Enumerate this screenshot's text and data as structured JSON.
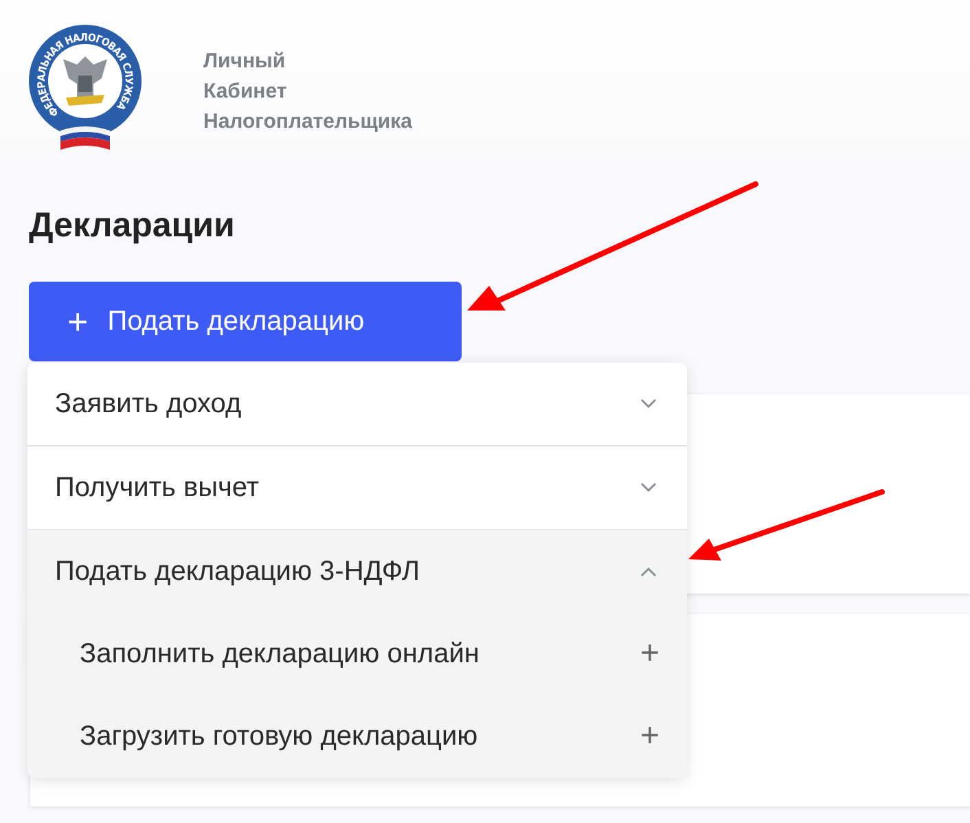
{
  "header": {
    "logo_ring_text": "ФЕДЕРАЛЬНАЯ НАЛОГОВАЯ СЛУЖБА",
    "title_lines": [
      "Личный",
      "Кабинет",
      "Налогоплательщика"
    ]
  },
  "page_title": "Декларации",
  "submit_button": {
    "icon": "+",
    "label": "Подать декларацию"
  },
  "menu": {
    "items": [
      {
        "label": "Заявить доход",
        "expanded": false
      },
      {
        "label": "Получить вычет",
        "expanded": false
      },
      {
        "label": "Подать декларацию 3-НДФЛ",
        "expanded": true,
        "children": [
          {
            "label": "Заполнить декларацию онлайн",
            "icon": "+"
          },
          {
            "label": "Загрузить готовую декларацию",
            "icon": "+"
          }
        ]
      }
    ]
  }
}
